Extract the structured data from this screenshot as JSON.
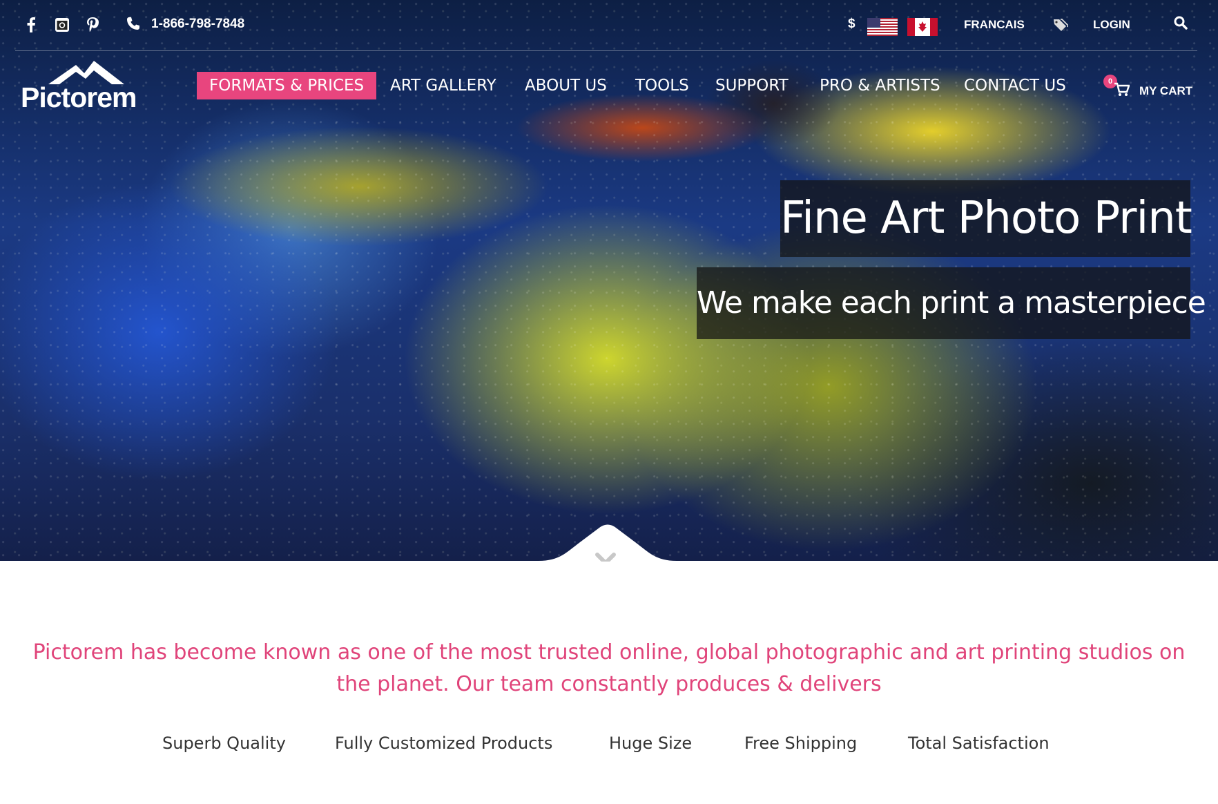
{
  "topbar": {
    "phone": "1-866-798-7848",
    "currency_symbol": "$",
    "language_link": "FRANCAIS",
    "login_link": "LOGIN",
    "icons": [
      "facebook-icon",
      "instagram-icon",
      "pinterest-icon",
      "phone-icon",
      "us-flag-icon",
      "canada-flag-icon",
      "tag-icon",
      "search-icon"
    ]
  },
  "logo": {
    "text": "Pictorem"
  },
  "nav": {
    "items": [
      {
        "label": "FORMATS & PRICES"
      },
      {
        "label": "ART GALLERY"
      },
      {
        "label": "ABOUT US"
      },
      {
        "label": "TOOLS"
      },
      {
        "label": "SUPPORT"
      },
      {
        "label": "PRO & ARTISTS"
      },
      {
        "label": "CONTACT US"
      }
    ],
    "active_index": 0,
    "active_color": "#e8457e"
  },
  "cart": {
    "count": "0",
    "label": "MY CART"
  },
  "hero": {
    "title": "Fine Art Photo Print",
    "subtitle": "We make each print a masterpiece"
  },
  "intro": {
    "text": "Pictorem has become known as one of the most trusted online, global photographic and art printing studios on the planet. Our team constantly produces & delivers",
    "color": "#e0447a"
  },
  "features": [
    "Superb Quality",
    "Fully Customized Products",
    "Huge Size",
    "Free Shipping",
    "Total Satisfaction"
  ]
}
